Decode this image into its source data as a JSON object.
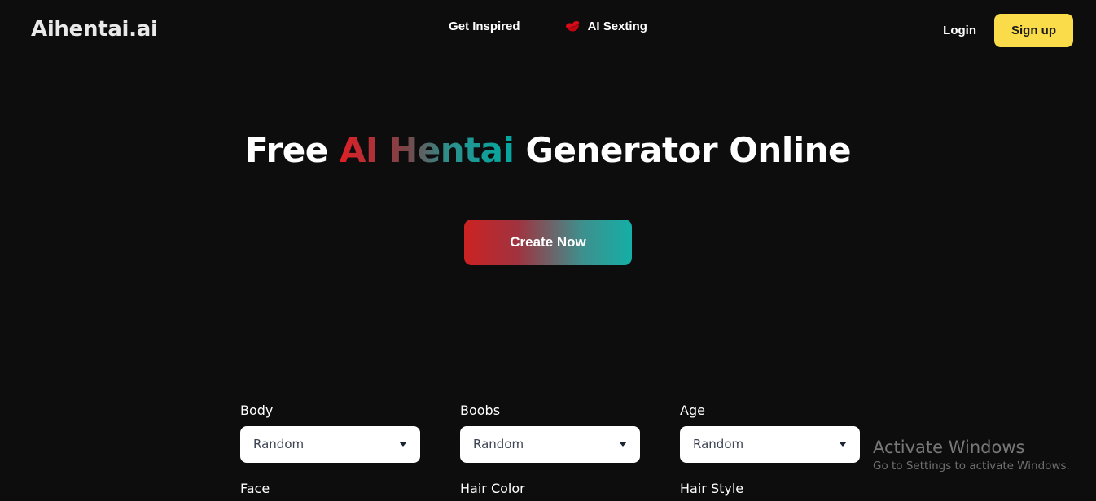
{
  "header": {
    "logo": "Aihentai.ai",
    "nav": [
      {
        "label": "Get Inspired",
        "icon": "none"
      },
      {
        "label": "AI Sexting",
        "icon": "lips-icon"
      }
    ],
    "login_label": "Login",
    "signup_label": "Sign up",
    "signup_bg": "#fadc4a"
  },
  "hero": {
    "title_part1": "Free ",
    "title_gradient": "AI Hentai",
    "title_part2": " Generator Online",
    "cta_label": "Create Now",
    "gradient_start": "#cc2222",
    "gradient_end": "#14afa6"
  },
  "form": {
    "row1": [
      {
        "label": "Body",
        "value": "Random"
      },
      {
        "label": "Boobs",
        "value": "Random"
      },
      {
        "label": "Age",
        "value": "Random"
      }
    ],
    "row2": [
      {
        "label": "Face"
      },
      {
        "label": "Hair Color"
      },
      {
        "label": "Hair Style"
      }
    ]
  },
  "watermark": {
    "title": "Activate Windows",
    "subtitle": "Go to Settings to activate Windows."
  }
}
